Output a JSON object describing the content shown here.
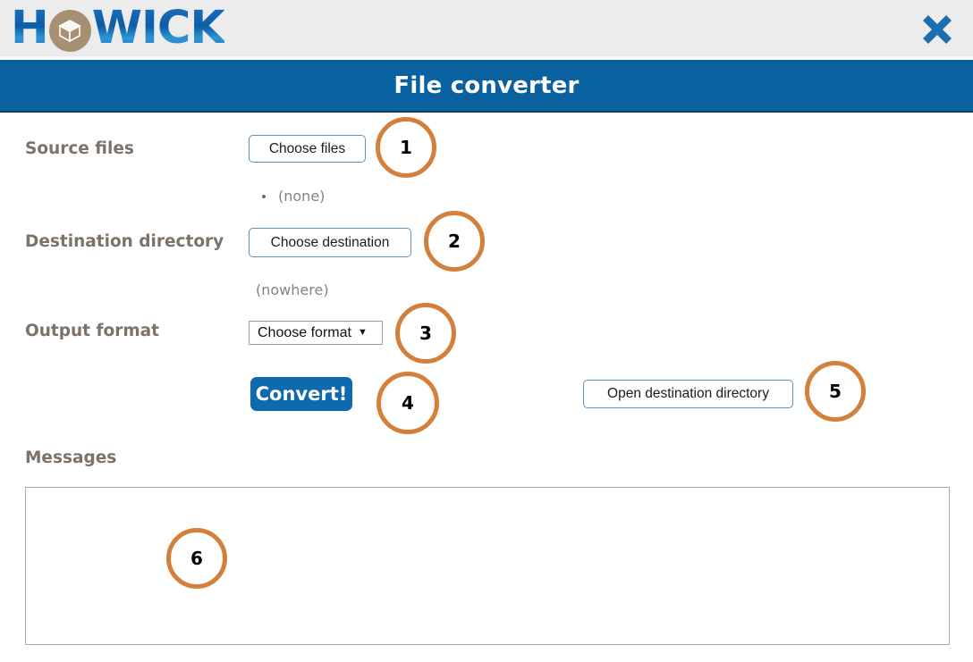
{
  "brand": {
    "logo_text_1": "H",
    "logo_text_2": "WICK",
    "logo_mark_icon": "cube-icon",
    "close_icon": "close-icon"
  },
  "titlebar": {
    "title": "File converter"
  },
  "form": {
    "source_files": {
      "label": "Source files",
      "button_label": "Choose files",
      "value": "(none)"
    },
    "destination_directory": {
      "label": "Destination directory",
      "button_label": "Choose destination",
      "value": "(nowhere)"
    },
    "output_format": {
      "label": "Output format",
      "selected": "Choose format",
      "caret": "▼"
    },
    "convert": {
      "label": "Convert!"
    },
    "open_destination": {
      "label": "Open destination directory"
    },
    "messages": {
      "label": "Messages",
      "content": ""
    }
  },
  "callouts": [
    {
      "number": "1"
    },
    {
      "number": "2"
    },
    {
      "number": "3"
    },
    {
      "number": "4"
    },
    {
      "number": "5"
    },
    {
      "number": "6"
    }
  ],
  "colors": {
    "header_bg": "#ececec",
    "titlebar_bg": "#09629f",
    "accent_blue": "#0d6aad",
    "label_gray": "#7d7268",
    "callout_orange": "#d2803b",
    "logo_mark_tan": "#a79072"
  }
}
